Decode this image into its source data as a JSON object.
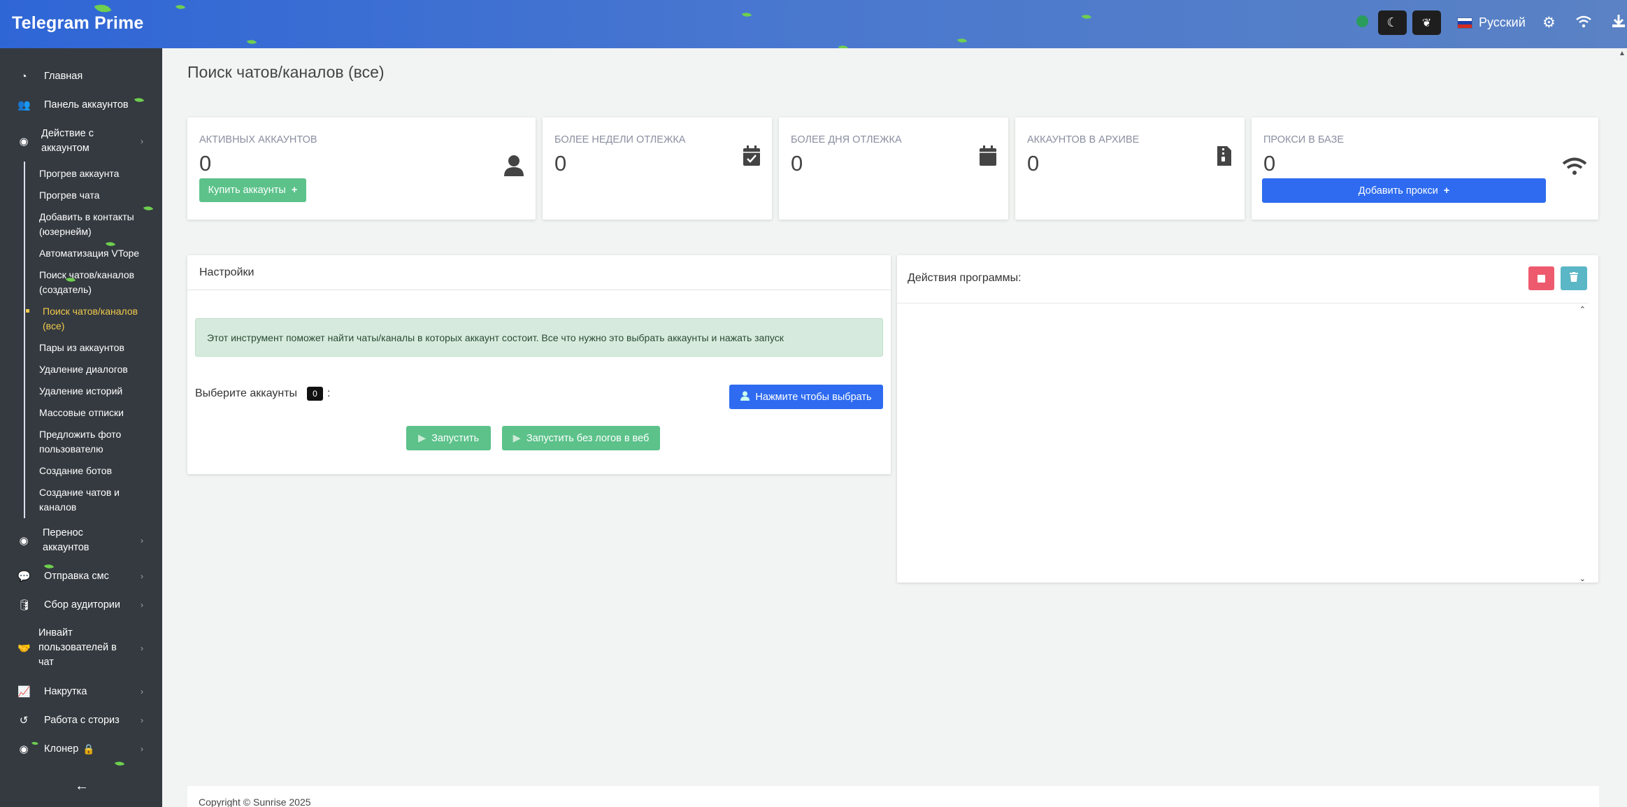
{
  "app": {
    "title": "Telegram Prime"
  },
  "header": {
    "language": "Русский"
  },
  "sidebar": {
    "items": [
      {
        "label": "Главная",
        "icon": "gauge-icon"
      },
      {
        "label": "Панель аккаунтов",
        "icon": "users-icon"
      },
      {
        "label": "Действие с аккаунтом",
        "icon": "user-circle-icon"
      }
    ],
    "sub_items": [
      "Прогрев аккаунта",
      "Прогрев чата",
      "Добавить в контакты (юзернейм)",
      "Автоматизация VTope",
      "Поиск чатов/каналов (создатель)",
      "Поиск чатов/каналов (все)",
      "Пары из аккаунтов",
      "Удаление диалогов",
      "Удаление историй",
      "Массовые отписки",
      "Предложить фото пользователю",
      "Создание ботов",
      "Создание чатов и каналов"
    ],
    "items_after": [
      {
        "label": "Перенос аккаунтов",
        "icon": "user-circle-icon"
      },
      {
        "label": "Отправка смс",
        "icon": "comments-icon"
      },
      {
        "label": "Сбор аудитории",
        "icon": "database-icon"
      },
      {
        "label": "Инвайт пользователей в чат",
        "icon": "handshake-icon"
      },
      {
        "label": "Накрутка",
        "icon": "chart-line-icon"
      },
      {
        "label": "Работа с сториз",
        "icon": "history-icon"
      },
      {
        "label": "Клонер",
        "icon": "user-circle-icon"
      }
    ]
  },
  "page": {
    "title": "Поиск чатов/каналов (все)"
  },
  "stats": [
    {
      "label": "АКТИВНЫХ АККАУНТОВ",
      "value": "0",
      "button": "Купить аккаунты"
    },
    {
      "label": "БОЛЕЕ НЕДЕЛИ ОТЛЕЖКА",
      "value": "0"
    },
    {
      "label": "БОЛЕЕ ДНЯ ОТЛЕЖКА",
      "value": "0"
    },
    {
      "label": "АККАУНТОВ В АРХИВЕ",
      "value": "0"
    },
    {
      "label": "ПРОКСИ В БАЗЕ",
      "value": "0",
      "button": "Добавить прокси"
    }
  ],
  "settings": {
    "title": "Настройки",
    "info": "Этот инструмент поможет найти чаты/каналы в которых аккаунт состоит. Все что нужно это выбрать аккаунты и нажать запуск",
    "select_label": "Выберите аккаунты",
    "select_count": "0",
    "select_suffix": ":",
    "select_button": "Нажмите чтобы выбрать",
    "run_button": "Запустить",
    "run_nolog_button": "Запустить без логов в веб"
  },
  "actions": {
    "title": "Действия программы:"
  },
  "footer": {
    "copyright": "Copyright © Sunrise 2025"
  },
  "colors": {
    "accent_blue": "#2e6bf0",
    "green": "#5cc28a",
    "sidebar": "#343a40",
    "active": "#f2c94c"
  }
}
